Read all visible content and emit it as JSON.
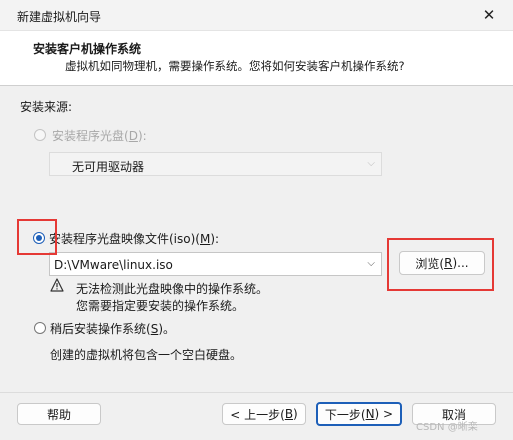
{
  "window": {
    "title": "新建虚拟机向导"
  },
  "header": {
    "title": "安装客户机操作系统",
    "subtitle": "虚拟机如同物理机，需要操作系统。您将如何安装客户机操作系统?"
  },
  "source_label": "安装来源:",
  "options": {
    "disc": {
      "label_pre": "安装程序光盘(",
      "key": "D",
      "label_post": "):",
      "drive_value": "无可用驱动器",
      "enabled": false
    },
    "iso": {
      "label_pre": "安装程序光盘映像文件(iso)(",
      "key": "M",
      "label_post": "):",
      "path_value": "D:\\VMware\\linux.iso",
      "selected": true
    },
    "later": {
      "label_pre": "稍后安装操作系统(",
      "key": "S",
      "label_post": ")。",
      "description": "创建的虚拟机将包含一个空白硬盘。"
    }
  },
  "browse": {
    "label_pre": "浏览(",
    "key": "R",
    "label_post": ")..."
  },
  "warning": {
    "line1": "无法检测此光盘映像中的操作系统。",
    "line2": "您需要指定要安装的操作系统。"
  },
  "footer": {
    "help": "帮助",
    "back_pre": "< 上一步(",
    "back_key": "B",
    "back_post": ")",
    "next_pre": "下一步(",
    "next_key": "N",
    "next_post": ") >",
    "cancel": "取消"
  },
  "watermark": "CSDN @晰栾",
  "colors": {
    "accent": "#1d5fb8",
    "highlight_box": "#e53935",
    "warning": "#333333"
  }
}
